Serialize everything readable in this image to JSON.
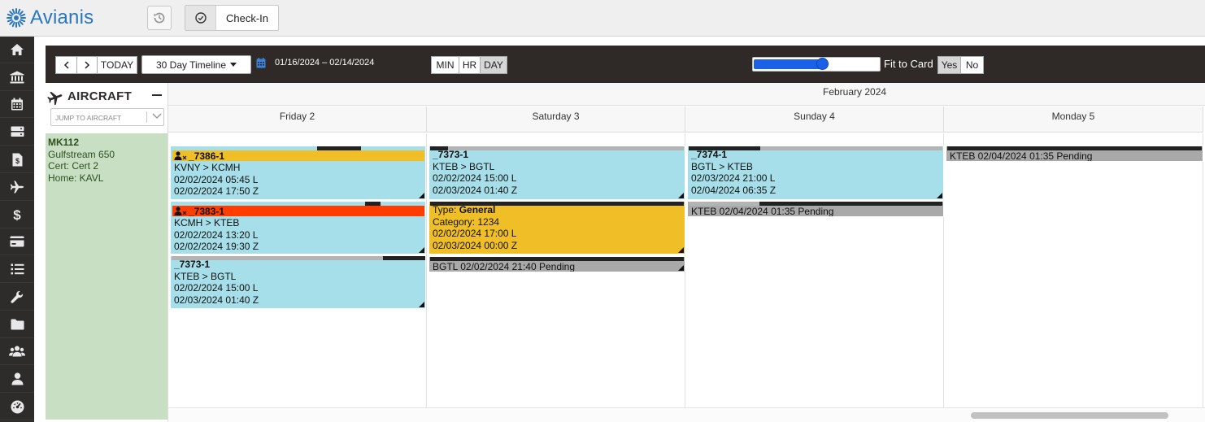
{
  "app": {
    "name": "Avianis",
    "colors": {
      "brand": "#2a77c0",
      "nav_bg": "#2e2c2b",
      "toolbar_bg": "#2f2a27",
      "trip_cyan": "#a6dfe9",
      "trip_yellow": "#f0bf27",
      "trip_orange": "#ff3d00",
      "pending_gray": "#a9a9a9",
      "aircraft_green": "#c8dfc4"
    }
  },
  "topbar": {
    "history_icon": "history-icon",
    "checkin_label": "Check-In",
    "checkin_icon": "check-circle-icon"
  },
  "sidenav": {
    "items": [
      {
        "icon": "home-icon"
      },
      {
        "icon": "bank-icon"
      },
      {
        "icon": "calendar-icon"
      },
      {
        "icon": "server-icon"
      },
      {
        "icon": "invoice-icon"
      },
      {
        "icon": "plane-icon"
      },
      {
        "icon": "dollar-icon"
      },
      {
        "icon": "credit-card-icon"
      },
      {
        "icon": "list-icon"
      },
      {
        "icon": "wrench-icon"
      },
      {
        "icon": "folder-icon"
      },
      {
        "icon": "users-icon"
      },
      {
        "icon": "user-icon"
      },
      {
        "icon": "dashboard-icon"
      }
    ]
  },
  "toolbar": {
    "prev": "<",
    "next": ">",
    "today": "TODAY",
    "view_select": "30 Day Timeline",
    "date_range": "01/16/2024 – 02/14/2024",
    "scale": [
      "MIN",
      "HR",
      "DAY"
    ],
    "scale_active": "DAY",
    "zoom_fraction": 0.55,
    "fit_to_card_label": "Fit to Card",
    "fit_yes": "Yes",
    "fit_no": "No",
    "fit_active": "Yes"
  },
  "aircraft_panel": {
    "title": "AIRCRAFT",
    "jump_placeholder": "JUMP TO AIRCRAFT",
    "aircraft": {
      "tail": "MK112",
      "type": "Gulfstream 650",
      "cert": "Cert: Cert 2",
      "home": "Home: KAVL"
    }
  },
  "calendar": {
    "month": "February 2024",
    "days": [
      "Friday 2",
      "Saturday 3",
      "Sunday 4",
      "Monday 5"
    ]
  },
  "events": {
    "e1": {
      "title": "_7386-1",
      "route": "KVNY > KCMH",
      "local": "02/02/2024 05:45 L",
      "zulu": "02/02/2024 17:50 Z"
    },
    "e2": {
      "title": "_7383-1",
      "route": "KCMH > KTEB",
      "local": "02/02/2024 13:20 L",
      "zulu": "02/02/2024 19:30 Z"
    },
    "e3": {
      "title": "_7373-1",
      "route": "KTEB > BGTL",
      "local": "02/02/2024 15:00 L",
      "zulu": "02/03/2024 01:40 Z"
    },
    "e4": {
      "title": "_7373-1",
      "route": "KTEB > BGTL",
      "local": "02/02/2024 15:00 L",
      "zulu": "02/03/2024 01:40 Z"
    },
    "e5": {
      "type_label": "Type: ",
      "type_value": "General",
      "category": "Category: 1234",
      "local": "02/02/2024 17:00 L",
      "zulu": "02/03/2024 00:00 Z"
    },
    "e6": {
      "text": "BGTL 02/02/2024 21:40 Pending"
    },
    "e7": {
      "title": "_7374-1",
      "route": "BGTL > KTEB",
      "local": "02/03/2024 21:00 L",
      "zulu": "02/04/2024 06:35 Z"
    },
    "e8": {
      "text": "KTEB 02/04/2024 01:35 Pending"
    },
    "e9": {
      "text": "KTEB 02/04/2024 01:35 Pending"
    }
  }
}
